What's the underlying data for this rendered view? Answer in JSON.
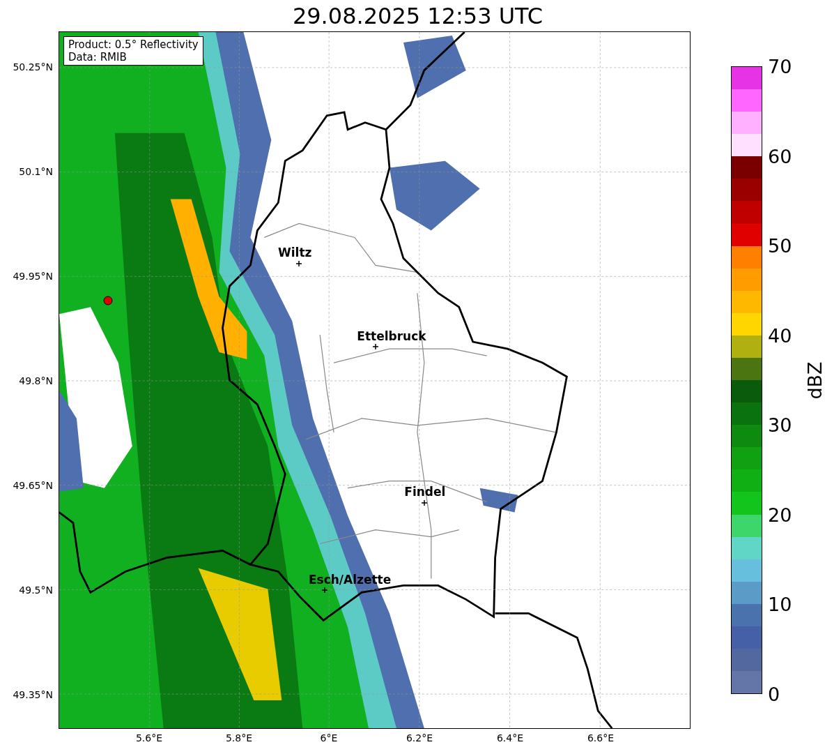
{
  "title": "29.08.2025 12:53 UTC",
  "info_box": [
    "Product: 0.5° Reflectivity",
    "Data: RMIB"
  ],
  "cities": [
    {
      "name": "Wiltz"
    },
    {
      "name": "Ettelbruck"
    },
    {
      "name": "Findel"
    },
    {
      "name": "Esch/Alzette"
    }
  ],
  "y_axis": {
    "ticks": [
      "50.25°N",
      "50.1°N",
      "49.95°N",
      "49.8°N",
      "49.65°N",
      "49.5°N",
      "49.35°N"
    ]
  },
  "x_axis": {
    "ticks": [
      "5.6°E",
      "5.8°E",
      "6°E",
      "6.2°E",
      "6.4°E",
      "6.6°E"
    ]
  },
  "colorbar": {
    "label": "dBZ",
    "ticks": [
      "70",
      "60",
      "50",
      "40",
      "30",
      "20",
      "10",
      "0"
    ],
    "bins": [
      {
        "color": "#e633e6"
      },
      {
        "color": "#ff66ff"
      },
      {
        "color": "#ffb0ff"
      },
      {
        "color": "#ffe0ff"
      },
      {
        "color": "#7a0000"
      },
      {
        "color": "#9a0000"
      },
      {
        "color": "#c00000"
      },
      {
        "color": "#e00000"
      },
      {
        "color": "#ff8000"
      },
      {
        "color": "#ff9c00"
      },
      {
        "color": "#ffb800"
      },
      {
        "color": "#ffd600"
      },
      {
        "color": "#b0b010"
      },
      {
        "color": "#4a7510"
      },
      {
        "color": "#0a5c0c"
      },
      {
        "color": "#0b7210"
      },
      {
        "color": "#0e8a10"
      },
      {
        "color": "#10a012"
      },
      {
        "color": "#10b014"
      },
      {
        "color": "#12c41c"
      },
      {
        "color": "#3dd66a"
      },
      {
        "color": "#5fd6c6"
      },
      {
        "color": "#66bfdd"
      },
      {
        "color": "#5a9bc8"
      },
      {
        "color": "#4a72ad"
      },
      {
        "color": "#4660a8"
      },
      {
        "color": "#52689f"
      },
      {
        "color": "#6475a8"
      }
    ]
  }
}
